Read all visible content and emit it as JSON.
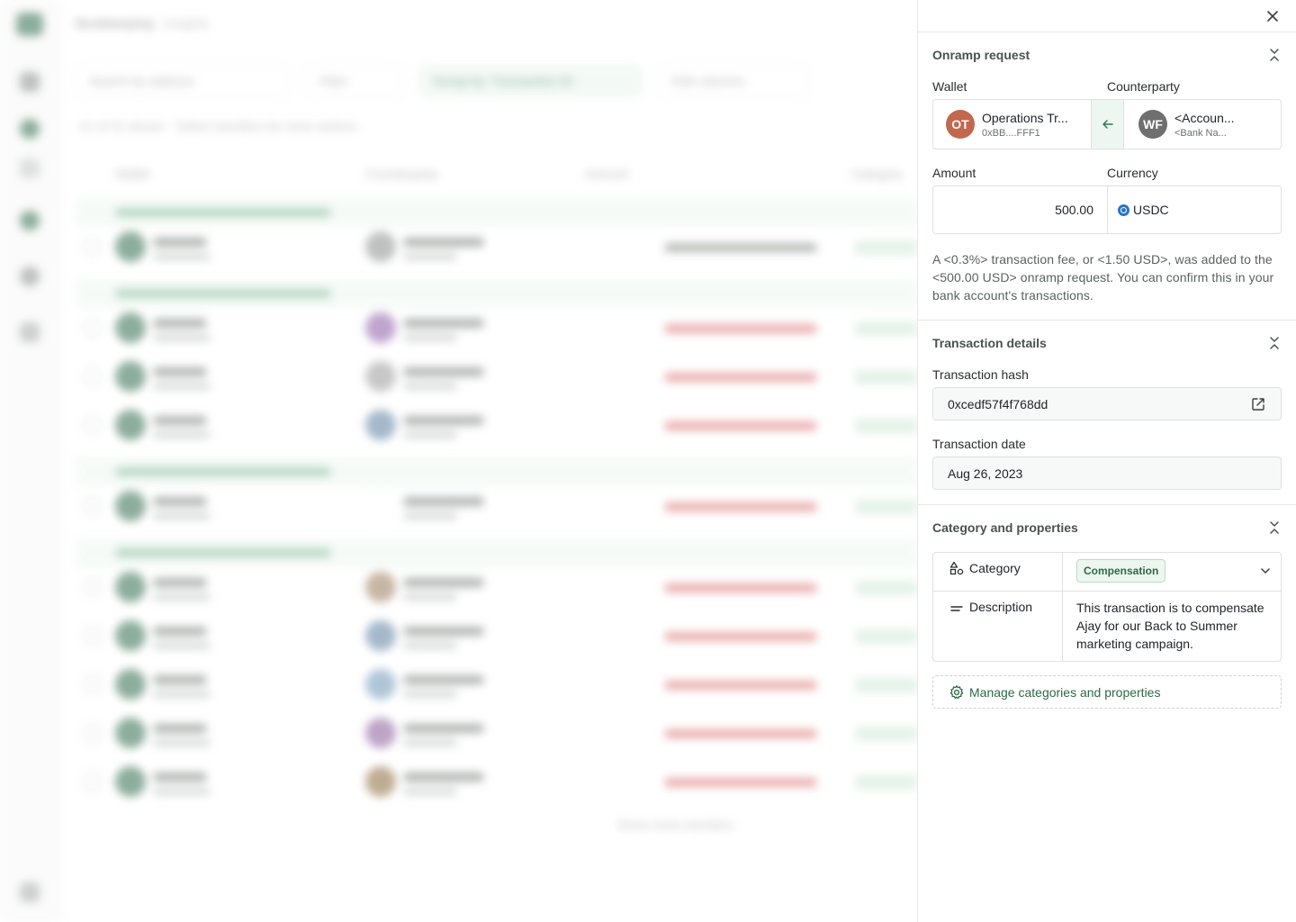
{
  "background": {
    "breadcrumb": [
      "Bookkeeping",
      "Insights"
    ],
    "toolbar": [
      "Search by address",
      "Filter",
      "Group by: Transaction ID",
      "Edit columns"
    ],
    "status": "41 of 41 shown · Select transfers for more actions",
    "columns": [
      "Wallet",
      "Counterparty",
      "Amount",
      "Category"
    ],
    "show_more": "Show more transfers"
  },
  "panel": {
    "onramp": {
      "title": "Onramp request",
      "wallet_label": "Wallet",
      "counterparty_label": "Counterparty",
      "wallet": {
        "initials": "OT",
        "name": "Operations Tr...",
        "address": "0xBB....FFF1",
        "color": "#c2684f"
      },
      "counterparty": {
        "initials": "WF",
        "name": "<Accoun...",
        "sub": "<Bank Na...",
        "color": "#6f6f6f"
      },
      "amount_label": "Amount",
      "currency_label": "Currency",
      "amount": "500.00",
      "currency": "USDC",
      "note": "A <0.3%> transaction fee, or <1.50 USD>, was added to the <500.00 USD> onramp request. You can confirm this in your bank account's transactions."
    },
    "tx_details": {
      "title": "Transaction details",
      "hash_label": "Transaction hash",
      "hash": "0xcedf57f4f768dd",
      "date_label": "Transaction date",
      "date": "Aug 26, 2023"
    },
    "category": {
      "title": "Category and properties",
      "category_label": "Category",
      "category_value": "Compensation",
      "description_label": "Description",
      "description": "This transaction is to compensate Ajay for our Back to Summer marketing campaign.",
      "manage_label": "Manage categories and properties"
    }
  }
}
